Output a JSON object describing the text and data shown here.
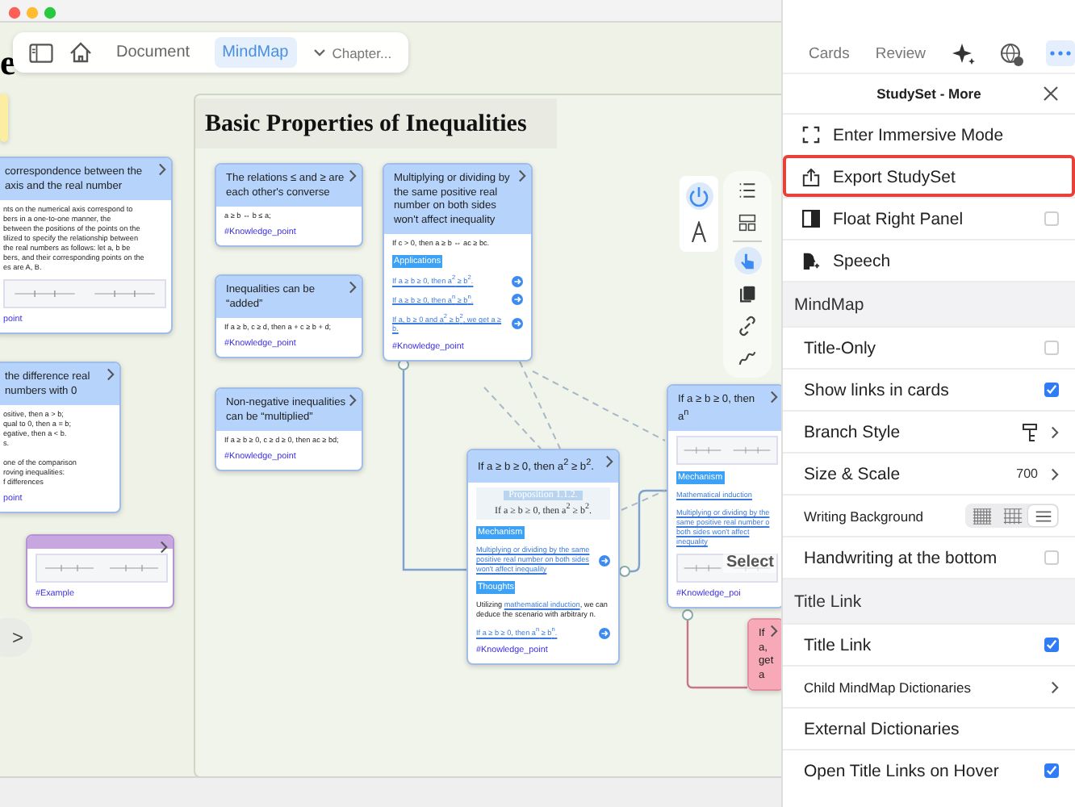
{
  "toolbar": {
    "tabs": [
      {
        "label": "Document",
        "selected": false
      },
      {
        "label": "MindMap",
        "selected": true
      }
    ],
    "chapter": "Chapter..."
  },
  "partial_title": "e",
  "outside_cards": [
    {
      "color": "#fbeea0"
    },
    {
      "color": "#b5d3fb",
      "title": "correspondence between the axis and the real number",
      "blocks": [
        {
          "kind": "text",
          "text": "nts on the numerical axis correspond to\nbers in a one-to-one manner, the\nbetween the positions of the points on the\ntilized to specify the relationship between\nthe real numbers as follows: let a, b be\nbers, and their corresponding points on the\nes are A, B."
        },
        {
          "kind": "image"
        },
        {
          "kind": "tag",
          "text": "point"
        }
      ]
    },
    {
      "color": "#b5d3fb",
      "title": "the difference real numbers with 0",
      "blocks": [
        {
          "kind": "text",
          "text": "ositive, then a > b;\nqual to 0, then a = b;\negative, then a < b.\ns.\n\none of the comparison\nroving inequalities:\nf differences"
        },
        {
          "kind": "tag",
          "text": "point"
        }
      ]
    },
    {
      "color": "#c8a6e0",
      "blocks": [
        {
          "kind": "image"
        },
        {
          "kind": "tag",
          "text": "#Example"
        }
      ]
    }
  ],
  "expand_button": ">",
  "group": {
    "title": "Basic Properties of Inequalities",
    "cards": [
      {
        "color": "#b5d3fb",
        "title": "The relations ≤ and ≥ are each other's converse",
        "blocks": [
          {
            "kind": "text",
            "text": "a ≥ b ⇔ b ≤ a;"
          },
          {
            "kind": "tag",
            "text": "#Knowledge_point"
          }
        ]
      },
      {
        "color": "#b5d3fb",
        "title": "Inequalities can be “added”",
        "blocks": [
          {
            "kind": "text",
            "text": "If a ≥ b, c ≥ d, then a + c ≥ b + d;"
          },
          {
            "kind": "tag",
            "text": "#Knowledge_point"
          }
        ]
      },
      {
        "color": "#b5d3fb",
        "title": "Non-negative inequalities can be “multiplied”",
        "blocks": [
          {
            "kind": "text",
            "text": "If a ≥ b ≥ 0, c ≥ d ≥ 0, then ac ≥ bd;"
          },
          {
            "kind": "tag",
            "text": "#Knowledge_point"
          }
        ]
      },
      {
        "color": "#b5d3fb",
        "title": "Multiplying or dividing by the same positive real number on both sides won't affect inequality",
        "blocks": [
          {
            "kind": "text",
            "text": "If c > 0, then a ≥ b ⇔ ac ≥ bc."
          },
          {
            "kind": "label",
            "text": "Applications"
          },
          {
            "kind": "link",
            "text": "If a ≥ b ≥ 0, then a$^{2}$ ≥ b$^{2}$.",
            "go": true
          },
          {
            "kind": "link",
            "text": "If a ≥ b ≥ 0, then a$^{n}$ ≥ b$^{n}$.",
            "go": true
          },
          {
            "kind": "link",
            "text": "If a, b ≥ 0 and a$^{2}$ ≥ b$^{2}$, we get a ≥ b.",
            "go": true
          },
          {
            "kind": "tag",
            "text": "#Knowledge_point"
          }
        ]
      },
      {
        "color": "#b5d3fb",
        "title": "If a ≥ b ≥ 0, then a$^{2}$ ≥ b$^{2}$.",
        "blocks": [
          {
            "kind": "figure",
            "caption": "Proposition 1.1.2.",
            "text": "If a ≥ b ≥ 0, then a$^{2}$ ≥ b$^{2}$."
          },
          {
            "kind": "label",
            "text": "Mechanism"
          },
          {
            "kind": "link",
            "text": "Multiplying or dividing by the same positive real number on both sides won't affect inequality",
            "go": true
          },
          {
            "kind": "label",
            "text": "Thoughts"
          },
          {
            "kind": "text",
            "text": "Utilizing ",
            "link": "mathematical induction",
            "after": ", we can deduce the scenario with arbitrary n."
          },
          {
            "kind": "link",
            "text": "If a ≥ b ≥ 0, then a$^{n}$ ≥ b$^{n}$.",
            "go": true
          },
          {
            "kind": "tag",
            "text": "#Knowledge_point"
          }
        ]
      },
      {
        "color": "#b5d3fb",
        "title": "If a ≥ b ≥ 0, then a$^{n}$",
        "blocks": [
          {
            "kind": "image"
          },
          {
            "kind": "label",
            "text": "Mechanism"
          },
          {
            "kind": "link",
            "text": "Mathematical induction",
            "go": false
          },
          {
            "kind": "link",
            "text": "Multiplying or dividing by the same positive real number o both sides won't affect inequality",
            "go": false
          },
          {
            "kind": "image"
          },
          {
            "kind": "tag",
            "text": "#Knowledge_poi"
          }
        ]
      },
      {
        "color": "#f7a9b8",
        "title": "If a, get a"
      }
    ]
  },
  "tools": [
    {
      "selected": true
    },
    {
      "selected": false
    }
  ],
  "side_tools": [
    {
      "selected": false
    },
    {
      "selected": false
    },
    {
      "selected": true
    },
    {
      "selected": false
    },
    {
      "selected": false
    },
    {
      "selected": false
    }
  ],
  "select_label": "Select",
  "panel": {
    "tabs": [
      {
        "kind": "text",
        "label": "Cards",
        "selected": false
      },
      {
        "kind": "text",
        "label": "Review",
        "selected": false
      },
      {
        "kind": "icon",
        "selected": false
      },
      {
        "kind": "icon",
        "selected": false
      },
      {
        "kind": "icon",
        "selected": true
      }
    ],
    "title": "StudySet - More",
    "items": [
      {
        "kind": "action",
        "label": "Enter Immersive Mode",
        "highlighted": false
      },
      {
        "kind": "action",
        "label": "Export StudySet",
        "highlighted": true
      },
      {
        "kind": "action",
        "label": "Float Right Panel",
        "checked": false,
        "highlighted": false
      },
      {
        "kind": "action",
        "label": "Speech",
        "highlighted": false
      },
      {
        "kind": "section",
        "label": "MindMap",
        "highlighted": false
      },
      {
        "kind": "toggle",
        "label": "Title-Only",
        "checked": false,
        "highlighted": false
      },
      {
        "kind": "toggle",
        "label": "Show links in cards",
        "checked": true,
        "highlighted": false
      },
      {
        "kind": "nav",
        "label": "Branch Style",
        "highlighted": false
      },
      {
        "kind": "nav",
        "label": "Size & Scale",
        "value": "700",
        "highlighted": false
      },
      {
        "kind": "segmented",
        "label": "Writing Background",
        "options": [
          {
            "selected": false
          },
          {
            "selected": false
          },
          {
            "selected": true
          }
        ],
        "highlighted": false
      },
      {
        "kind": "toggle",
        "label": "Handwriting at the bottom",
        "checked": false,
        "highlighted": false
      },
      {
        "kind": "section",
        "label": "Title Link",
        "highlighted": false
      },
      {
        "kind": "toggle",
        "label": "Title Link",
        "checked": true,
        "highlighted": false
      },
      {
        "kind": "nav",
        "label": "Child MindMap Dictionaries",
        "highlighted": false
      },
      {
        "kind": "plain",
        "label": "External Dictionaries",
        "highlighted": false
      },
      {
        "kind": "toggle",
        "label": "Open Title Links on Hover",
        "checked": true,
        "highlighted": false
      }
    ]
  }
}
